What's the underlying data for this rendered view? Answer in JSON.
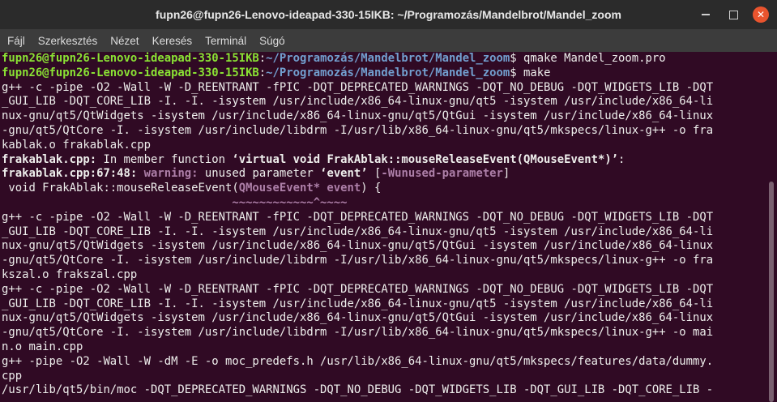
{
  "window": {
    "title": "fupn26@fupn26-Lenovo-ideapad-330-15IKB: ~/Programozás/Mandelbrot/Mandel_zoom",
    "close_glyph": "✕"
  },
  "menu": [
    "Fájl",
    "Szerkesztés",
    "Nézet",
    "Keresés",
    "Terminál",
    "Súgó"
  ],
  "terminal": {
    "prompt_userhost": "fupn26@fupn26-Lenovo-ideapad-330-15IKB",
    "prompt_path": "~/Programozás/Mandelbrot/Mandel_zoom",
    "cmd1": "$ qmake Mandel_zoom.pro",
    "cmd2": "$ make",
    "lines": [
      "g++ -c -pipe -O2 -Wall -W -D_REENTRANT -fPIC -DQT_DEPRECATED_WARNINGS -DQT_NO_DEBUG -DQT_WIDGETS_LIB -DQT",
      "_GUI_LIB -DQT_CORE_LIB -I. -I. -isystem /usr/include/x86_64-linux-gnu/qt5 -isystem /usr/include/x86_64-li",
      "nux-gnu/qt5/QtWidgets -isystem /usr/include/x86_64-linux-gnu/qt5/QtGui -isystem /usr/include/x86_64-linux",
      "-gnu/qt5/QtCore -I. -isystem /usr/include/libdrm -I/usr/lib/x86_64-linux-gnu/qt5/mkspecs/linux-g++ -o fra",
      "kablak.o frakablak.cpp",
      "g++ -c -pipe -O2 -Wall -W -D_REENTRANT -fPIC -DQT_DEPRECATED_WARNINGS -DQT_NO_DEBUG -DQT_WIDGETS_LIB -DQT",
      "_GUI_LIB -DQT_CORE_LIB -I. -I. -isystem /usr/include/x86_64-linux-gnu/qt5 -isystem /usr/include/x86_64-li",
      "nux-gnu/qt5/QtWidgets -isystem /usr/include/x86_64-linux-gnu/qt5/QtGui -isystem /usr/include/x86_64-linux",
      "-gnu/qt5/QtCore -I. -isystem /usr/include/libdrm -I/usr/lib/x86_64-linux-gnu/qt5/mkspecs/linux-g++ -o fra",
      "kszal.o frakszal.cpp",
      "g++ -c -pipe -O2 -Wall -W -D_REENTRANT -fPIC -DQT_DEPRECATED_WARNINGS -DQT_NO_DEBUG -DQT_WIDGETS_LIB -DQT",
      "_GUI_LIB -DQT_CORE_LIB -I. -I. -isystem /usr/include/x86_64-linux-gnu/qt5 -isystem /usr/include/x86_64-li",
      "nux-gnu/qt5/QtWidgets -isystem /usr/include/x86_64-linux-gnu/qt5/QtGui -isystem /usr/include/x86_64-linux",
      "-gnu/qt5/QtCore -I. -isystem /usr/include/libdrm -I/usr/lib/x86_64-linux-gnu/qt5/mkspecs/linux-g++ -o mai",
      "n.o main.cpp",
      "g++ -pipe -O2 -Wall -W -dM -E -o moc_predefs.h /usr/lib/x86_64-linux-gnu/qt5/mkspecs/features/data/dummy.",
      "cpp",
      "/usr/lib/qt5/bin/moc -DQT_DEPRECATED_WARNINGS -DQT_NO_DEBUG -DQT_WIDGETS_LIB -DQT_GUI_LIB -DQT_CORE_LIB -"
    ],
    "warn1_file": "frakablak.cpp:",
    "warn1_text": " In member function ",
    "warn1_fn": "‘virtual void FrakAblak::mouseReleaseEvent(QMouseEvent*)’",
    "warn1_end": ":",
    "warn2_loc": "frakablak.cpp:67:48:",
    "warn2_label": " warning:",
    "warn2_text": " unused parameter ",
    "warn2_param": "‘event’",
    "warn2_flag_open": " [",
    "warn2_flag": "-Wunused-parameter",
    "warn2_flag_close": "]",
    "src_pre": " void FrakAblak::mouseReleaseEvent(",
    "src_hl": "QMouseEvent* event",
    "src_post": ") {",
    "caret_pad": "                                  ",
    "caret": "~~~~~~~~~~~~^~~~~"
  }
}
